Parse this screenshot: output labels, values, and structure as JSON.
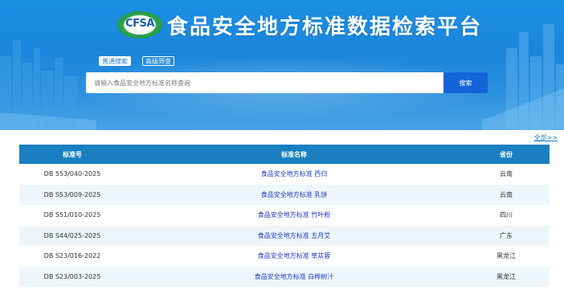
{
  "header": {
    "logo_text": "CFSA",
    "title": "食品安全地方标准数据检索平台"
  },
  "search": {
    "tabs": [
      {
        "label": "普通搜索",
        "active": true
      },
      {
        "label": "高级筛查",
        "active": false
      }
    ],
    "placeholder": "请输入食品安全地方标准名称查询",
    "button_label": "搜索"
  },
  "more_link": "全部>>",
  "table": {
    "columns": [
      "标准号",
      "标准名称",
      "省份"
    ],
    "rows": [
      {
        "number": "DB 553/040-2025",
        "name": "食品安全地方标准 西归",
        "province": "云南"
      },
      {
        "number": "DB S53/009-2025",
        "name": "食品安全地方标准 乳饼",
        "province": "云南"
      },
      {
        "number": "DB S51/010-2025",
        "name": "食品安全地方标准 竹叶粉",
        "province": "四川"
      },
      {
        "number": "DB S44/025-2025",
        "name": "食品安全地方标准 五月艾",
        "province": "广东"
      },
      {
        "number": "DB S23/016-2022",
        "name": "食品安全地方标准 草苁蓉",
        "province": "黑龙江"
      },
      {
        "number": "DB S23/003-2025",
        "name": "食品安全地方标准 白桦树汁",
        "province": "黑龙江"
      }
    ]
  },
  "colors": {
    "banner": "#1b8fe3",
    "table_header": "#1a7fc1",
    "search_button": "#1563d8",
    "link": "#1a3cc9"
  }
}
